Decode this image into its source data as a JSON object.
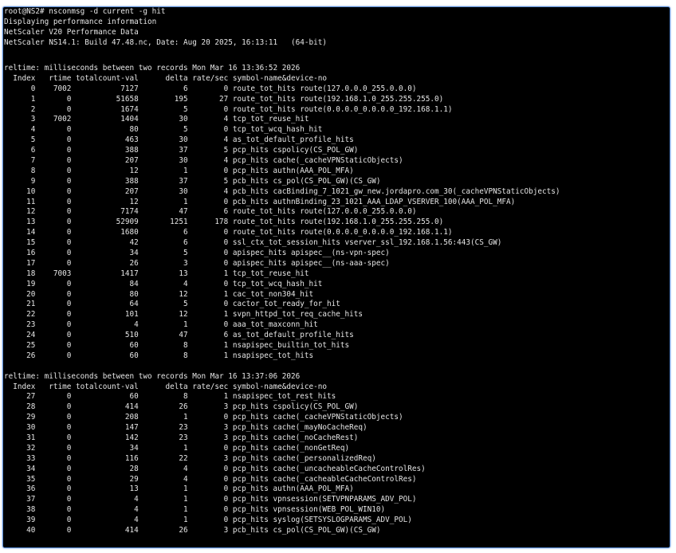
{
  "terminal": {
    "header": [
      "root@NS2# nsconmsg -d current -g hit",
      "Displaying performance information",
      "NetScaler V20 Performance Data",
      "NetScaler NS14.1: Build 47.48.nc, Date: Aug 20 2025, 16:13:11   (64-bit)"
    ],
    "blocks": [
      {
        "reltime": "reltime: milliseconds between two records Mon Mar 16 13:36:52 2026",
        "columns": "  Index   rtime totalcount-val      delta rate/sec symbol-name&device-no",
        "rows": [
          "      0    7002           7127          6        0 route_tot_hits route(127.0.0.0_255.0.0.0)",
          "      1       0          51658        195       27 route_tot_hits route(192.168.1.0_255.255.255.0)",
          "      2       0           1674          5        0 route_tot_hits route(0.0.0.0_0.0.0.0_192.168.1.1)",
          "      3    7002           1404         30        4 tcp_tot_reuse_hit",
          "      4       0             80          5        0 tcp_tot_wcq_hash_hit",
          "      5       0            463         30        4 as_tot_default_profile_hits",
          "      6       0            388         37        5 pcp_hits cspolicy(CS_POL_GW)",
          "      7       0            207         30        4 pcp_hits cache(_cacheVPNStaticObjects)",
          "      8       0             12          1        0 pcp_hits authn(AAA_POL_MFA)",
          "      9       0            388         37        5 pcb_hits cs_pol(CS_POL_GW)(CS_GW)",
          "     10       0            207         30        4 pcb_hits cacBinding_7_1021_gw_new.jordapro.com_30(_cacheVPNStaticObjects)",
          "     11       0             12          1        0 pcb_hits authnBinding_23_1021_AAA_LDAP_VSERVER_100(AAA_POL_MFA)",
          "     12       0           7174         47        6 route_tot_hits route(127.0.0.0_255.0.0.0)",
          "     13       0          52909       1251      178 route_tot_hits route(192.168.1.0_255.255.255.0)",
          "     14       0           1680          6        0 route_tot_hits route(0.0.0.0_0.0.0.0_192.168.1.1)",
          "     15       0             42          6        0 ssl_ctx_tot_session_hits vserver_ssl_192.168.1.56:443(CS_GW)",
          "     16       0             34          5        0 apispec_hits apispec__(ns-vpn-spec)",
          "     17       0             26          3        0 apispec_hits apispec__(ns-aaa-spec)",
          "     18    7003           1417         13        1 tcp_tot_reuse_hit",
          "     19       0             84          4        0 tcp_tot_wcq_hash_hit",
          "     20       0             80         12        1 cac_tot_non304_hit",
          "     21       0             64          5        0 cactor_tot_ready_for_hit",
          "     22       0            101         12        1 svpn_httpd_tot_req_cache_hits",
          "     23       0              4          1        0 aaa_tot_maxconn_hit",
          "     24       0            510         47        6 as_tot_default_profile_hits",
          "     25       0             60          8        1 nsapispec_builtin_tot_hits",
          "     26       0             60          8        1 nsapispec_tot_hits"
        ]
      },
      {
        "reltime": "reltime: milliseconds between two records Mon Mar 16 13:37:06 2026",
        "columns": "  Index   rtime totalcount-val      delta rate/sec symbol-name&device-no",
        "rows": [
          "     27       0             60          8        1 nsapispec_tot_rest_hits",
          "     28       0            414         26        3 pcp_hits cspolicy(CS_POL_GW)",
          "     29       0            208          1        0 pcp_hits cache(_cacheVPNStaticObjects)",
          "     30       0            147         23        3 pcp_hits cache(_mayNoCacheReq)",
          "     31       0            142         23        3 pcp_hits cache(_noCacheRest)",
          "     32       0             34          1        0 pcp_hits cache(_nonGetReq)",
          "     33       0            116         22        3 pcp_hits cache(_personalizedReq)",
          "     34       0             28          4        0 pcp_hits cache(_uncacheableCacheControlRes)",
          "     35       0             29          4        0 pcp_hits cache(_cacheableCacheControlRes)",
          "     36       0             13          1        0 pcp_hits authn(AAA_POL_MFA)",
          "     37       0              4          1        0 pcp_hits vpnsession(SETVPNPARAMS_ADV_POL)",
          "     38       0              4          1        0 pcp_hits vpnsession(WEB_POL_WIN10)",
          "     39       0              4          1        0 pcp_hits syslog(SETSYSLOGPARAMS_ADV_POL)",
          "     40       0            414         26        3 pcb_hits cs_pol(CS_POL_GW)(CS_GW)"
        ]
      }
    ]
  }
}
